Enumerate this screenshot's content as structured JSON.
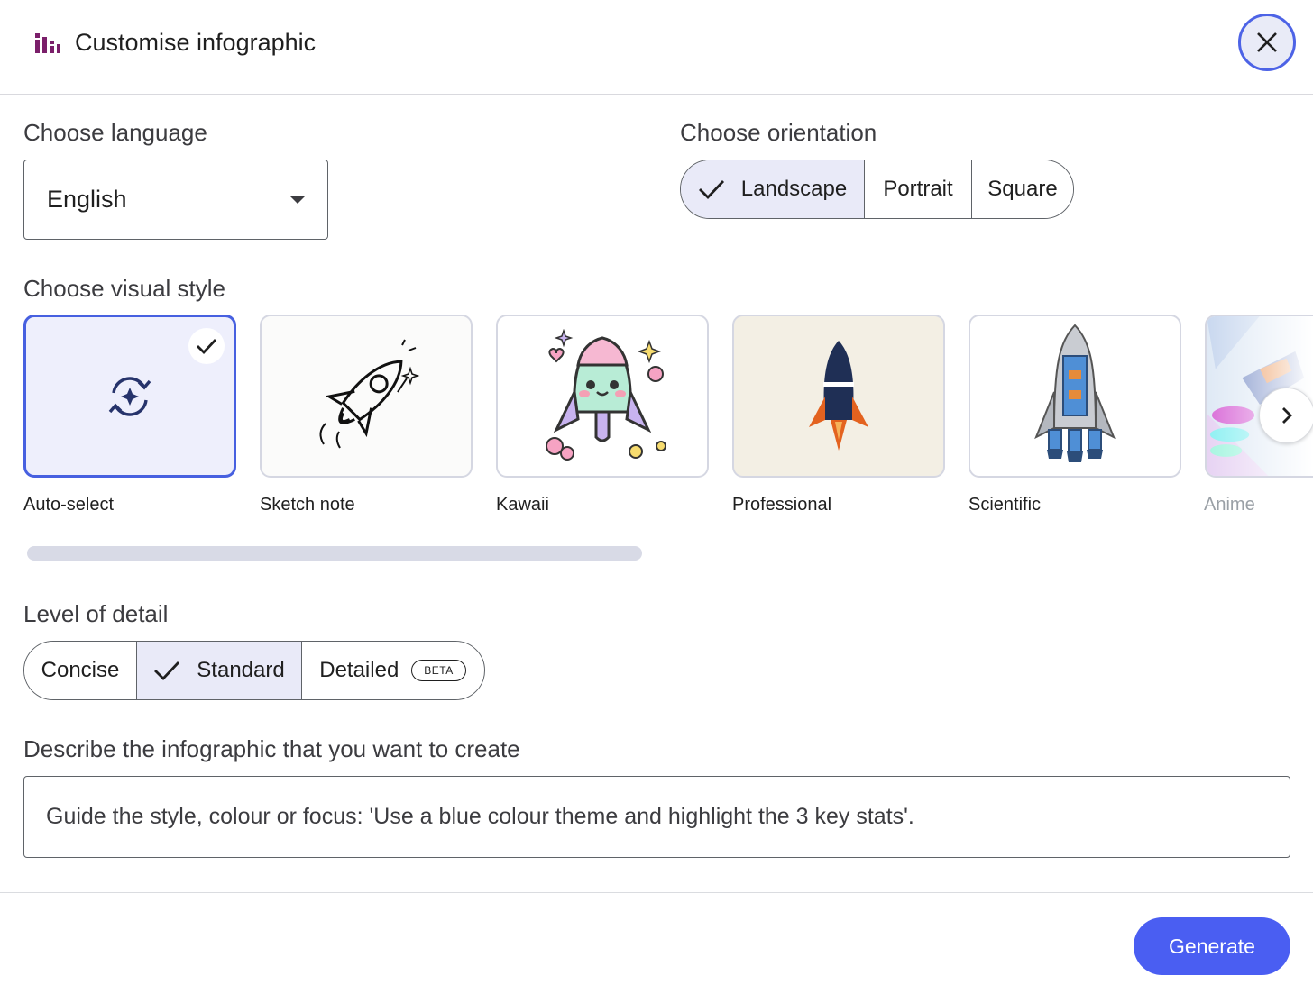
{
  "header": {
    "title": "Customise infographic",
    "logo_icon": "bar-chart-icon",
    "logo_color": "#7b1f6a",
    "close_icon": "close-icon"
  },
  "language": {
    "label": "Choose language",
    "value": "English",
    "icon": "dropdown-caret-icon"
  },
  "orientation": {
    "label": "Choose orientation",
    "options": [
      "Landscape",
      "Portrait",
      "Square"
    ],
    "selected": "Landscape"
  },
  "visual_style": {
    "label": "Choose visual style",
    "items": [
      {
        "label": "Auto-select",
        "icon": "auto-select-sync-icon",
        "selected": true
      },
      {
        "label": "Sketch note",
        "icon": "sketch-rocket-icon"
      },
      {
        "label": "Kawaii",
        "icon": "kawaii-rocket-icon"
      },
      {
        "label": "Professional",
        "icon": "professional-rocket-icon"
      },
      {
        "label": "Scientific",
        "icon": "scientific-rocket-icon"
      },
      {
        "label": "Anime",
        "icon": "anime-rocket-icon"
      }
    ],
    "next_icon": "chevron-right-icon"
  },
  "detail": {
    "label": "Level of detail",
    "options": [
      "Concise",
      "Standard",
      "Detailed"
    ],
    "selected": "Standard",
    "beta_badge": "BETA"
  },
  "describe": {
    "label": "Describe the infographic that you want to create",
    "placeholder": "Guide the style, colour or focus: 'Use a blue colour theme and highlight the 3 key stats'."
  },
  "footer": {
    "generate_label": "Generate",
    "accent": "#4a5ef2"
  }
}
